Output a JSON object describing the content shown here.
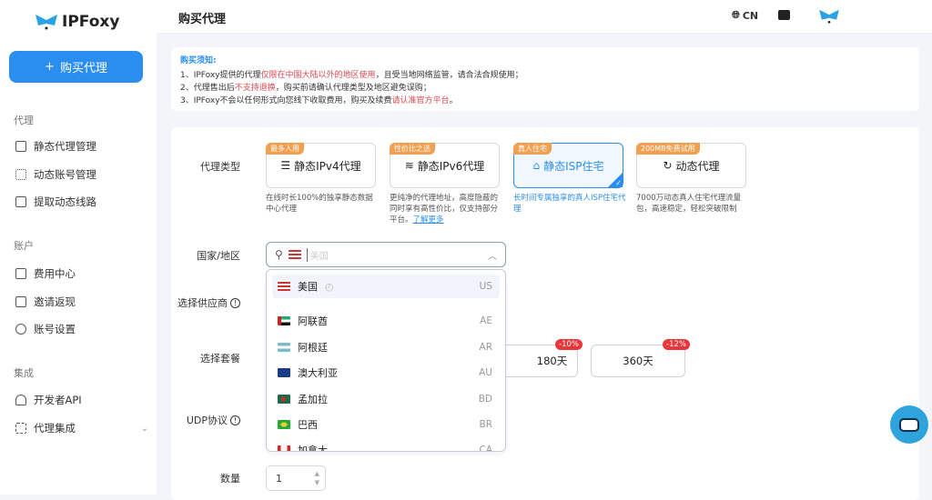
{
  "brand": {
    "name": "IPFoxy"
  },
  "sidebar": {
    "buy_button": "购买代理",
    "sections": [
      {
        "title": "代理",
        "items": [
          {
            "label": "静态代理管理",
            "icon": "monitor-icon"
          },
          {
            "label": "动态账号管理",
            "icon": "accounts-icon"
          },
          {
            "label": "提取动态线路",
            "icon": "server-icon"
          }
        ]
      },
      {
        "title": "账户",
        "items": [
          {
            "label": "费用中心",
            "icon": "card-icon"
          },
          {
            "label": "邀请返现",
            "icon": "dollar-icon"
          },
          {
            "label": "账号设置",
            "icon": "user-icon"
          }
        ]
      },
      {
        "title": "集成",
        "items": [
          {
            "label": "开发者API",
            "icon": "fingerprint-icon"
          },
          {
            "label": "代理集成",
            "icon": "command-icon"
          }
        ]
      }
    ]
  },
  "header": {
    "title": "购买代理",
    "lang": "CN"
  },
  "notice": {
    "title": "购买须知:",
    "lines": [
      {
        "a": "1、IPFoxy提供的代理",
        "b": "仅限在中国大陆以外的地区使用",
        "c": "，且受当地网络监管，请合法合规使用；"
      },
      {
        "a": "2、代理售出后",
        "b": "不支持退换",
        "c": "，购买前请确认代理类型及地区避免误购；"
      },
      {
        "a": "3、IPFoxy不会以任何形式向您线下收取费用，购买及续费",
        "b": "请认准官方平台",
        "c": "。"
      }
    ]
  },
  "form": {
    "labels": {
      "type": "代理类型",
      "country": "国家/地区",
      "supplier": "选择供应商",
      "package": "选择套餐",
      "udp": "UDP协议",
      "qty": "数量"
    },
    "proxy_types": [
      {
        "tag": "最多人用",
        "label": "静态IPv4代理",
        "desc": "在线时长100%的独享静态数据中心代理"
      },
      {
        "tag": "性价比之选",
        "label": "静态IPv6代理",
        "desc": "更纯净的代理地址，高度隐蔽的同时享有高性价比，仅支持部分平台。",
        "link": "了解更多"
      },
      {
        "tag": "真人住宅",
        "label": "静态ISP住宅",
        "desc": "长时间专属独享的真人ISP住宅代理",
        "selected": true
      },
      {
        "tag": "200MB免费试用",
        "label": "动态代理",
        "desc": "7000万动态真人住宅代理流量包，高速稳定，轻松突破限制"
      }
    ],
    "country_placeholder": "美国",
    "countries": [
      {
        "name": "美国",
        "code": "US"
      },
      {
        "name": "阿联酋",
        "code": "AE"
      },
      {
        "name": "阿根廷",
        "code": "AR"
      },
      {
        "name": "澳大利亚",
        "code": "AU"
      },
      {
        "name": "孟加拉",
        "code": "BD"
      },
      {
        "name": "巴西",
        "code": "BR"
      },
      {
        "name": "加拿大",
        "code": "CA"
      }
    ],
    "packages": [
      {
        "label": "180天",
        "discount": "-10%"
      },
      {
        "label": "360天",
        "discount": "-12%"
      }
    ],
    "quantity": "1"
  },
  "colors": {
    "accent": "#2a8ef0",
    "tag": "#f0a050",
    "discount": "#e8363a"
  }
}
